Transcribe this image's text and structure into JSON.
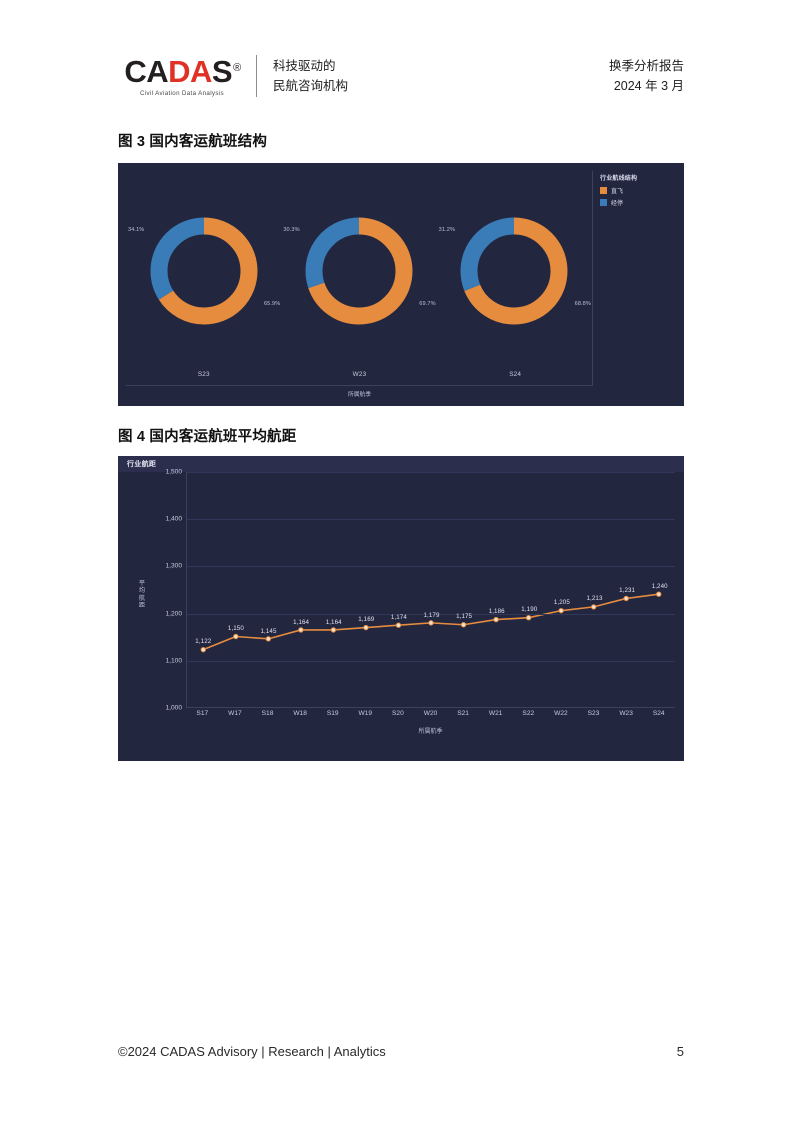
{
  "header": {
    "logo_text_parts": [
      "C",
      "AD",
      "A",
      "S"
    ],
    "logo_text": "CADAS",
    "logo_registered": "®",
    "logo_subtitle": "Civil Aviation Data Analysis",
    "tagline_line1": "科技驱动的",
    "tagline_line2": "民航咨询机构",
    "report_title": "换季分析报告",
    "report_date": "2024 年 3 月",
    "brand_red": "#e03127",
    "brand_black": "#231f20"
  },
  "figures": [
    {
      "caption": "图 3  国内客运航班结构",
      "chart_data": {
        "type": "pie",
        "title": "行业航线结构",
        "xlabel": "所属航季",
        "ylabel": "",
        "legend_position": "right",
        "legend": [
          "直飞",
          "经停"
        ],
        "colors": [
          "#e58c3f",
          "#3a7cb8"
        ],
        "categories": [
          "S23",
          "W23",
          "S24"
        ],
        "series": [
          {
            "name": "直飞",
            "values": [
              65.9,
              69.7,
              68.8
            ],
            "labels": [
              "65.9%",
              "69.7%",
              "68.8%"
            ]
          },
          {
            "name": "经停",
            "values": [
              34.1,
              30.3,
              31.2
            ],
            "labels": [
              "34.1%",
              "30.3%",
              "31.2%"
            ]
          }
        ],
        "donuts": [
          {
            "category": "S23",
            "orange_label": "65.9%",
            "blue_label": "34.1%",
            "orange": 65.9,
            "blue": 34.1
          },
          {
            "category": "W23",
            "orange_label": "69.7%",
            "blue_label": "30.3%",
            "orange": 69.7,
            "blue": 30.3
          },
          {
            "category": "S24",
            "orange_label": "68.8%",
            "blue_label": "31.2%",
            "orange": 68.8,
            "blue": 31.2
          }
        ]
      }
    },
    {
      "caption": "图 4  国内客运航班平均航距",
      "chart_data": {
        "type": "line",
        "title": "行业航距",
        "xlabel": "所属航季",
        "ylabel": "平均航距",
        "grid": true,
        "legend_position": "none",
        "line_color": "#e58c3f",
        "ylim": [
          1000,
          1500
        ],
        "yticks": [
          1000,
          1100,
          1200,
          1300,
          1400,
          1500
        ],
        "ytick_labels": [
          "1,000",
          "1,100",
          "1,200",
          "1,300",
          "1,400",
          "1,500"
        ],
        "categories": [
          "S17",
          "W17",
          "S18",
          "W18",
          "S19",
          "W19",
          "S20",
          "W20",
          "S21",
          "W21",
          "S22",
          "W22",
          "S23",
          "W23",
          "S24"
        ],
        "values": [
          1122,
          1150,
          1145,
          1164,
          1164,
          1169,
          1174,
          1179,
          1175,
          1186,
          1190,
          1205,
          1213,
          1231,
          1240
        ],
        "value_labels": [
          "1,122",
          "1,150",
          "1,145",
          "1,164",
          "1,164",
          "1,169",
          "1,174",
          "1,179",
          "1,175",
          "1,186",
          "1,190",
          "1,205",
          "1,213",
          "1,231",
          "1,240"
        ]
      }
    }
  ],
  "footer": {
    "copyright": "©2024 CADAS Advisory | Research | Analytics",
    "page_number": "5"
  },
  "theme": {
    "panel_background": "#23263f",
    "panel_header": "#2b2f4d",
    "grid_color": "#313758",
    "axis_text": "#c6ccdf"
  }
}
